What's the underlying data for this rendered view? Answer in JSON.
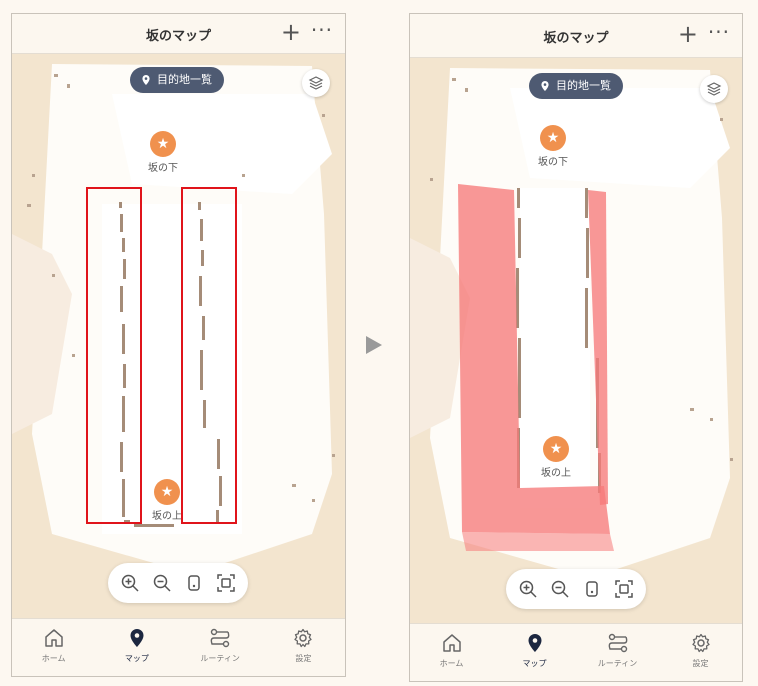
{
  "before": {
    "header": {
      "title": "坂のマップ",
      "plus": "+",
      "more": "···"
    },
    "destination_button": {
      "label": "目的地一覧",
      "icon": "pin-icon"
    },
    "markers": [
      {
        "label": "坂の下",
        "icon": "star-icon",
        "glyph": "★"
      },
      {
        "label": "坂の上",
        "icon": "star-icon",
        "glyph": "★"
      }
    ],
    "tabs": [
      {
        "label": "ホーム",
        "icon": "home-icon"
      },
      {
        "label": "マップ",
        "icon": "map-pin-icon",
        "active": true
      },
      {
        "label": "ルーティン",
        "icon": "routine-icon"
      },
      {
        "label": "設定",
        "icon": "gear-icon"
      }
    ]
  },
  "after": {
    "header": {
      "title": "坂のマップ",
      "plus": "+",
      "more": "···"
    },
    "destination_button": {
      "label": "目的地一覧",
      "icon": "pin-icon"
    },
    "markers": [
      {
        "label": "坂の下",
        "icon": "star-icon",
        "glyph": "★"
      },
      {
        "label": "坂の上",
        "icon": "star-icon",
        "glyph": "★"
      }
    ],
    "tabs": [
      {
        "label": "ホーム",
        "icon": "home-icon"
      },
      {
        "label": "マップ",
        "icon": "map-pin-icon",
        "active": true
      },
      {
        "label": "ルーティン",
        "icon": "routine-icon"
      },
      {
        "label": "設定",
        "icon": "gear-icon"
      }
    ]
  },
  "colors": {
    "map_background": "#f3e5cf",
    "map_cleared": "#ffffff",
    "wall_pixels": "#a58c78",
    "highlight_outline": "#e0141b",
    "highlight_fill": "#f67a7a",
    "marker": "#f0914e",
    "destination_button": "#4e5a72",
    "active_tab": "#1c2740"
  }
}
